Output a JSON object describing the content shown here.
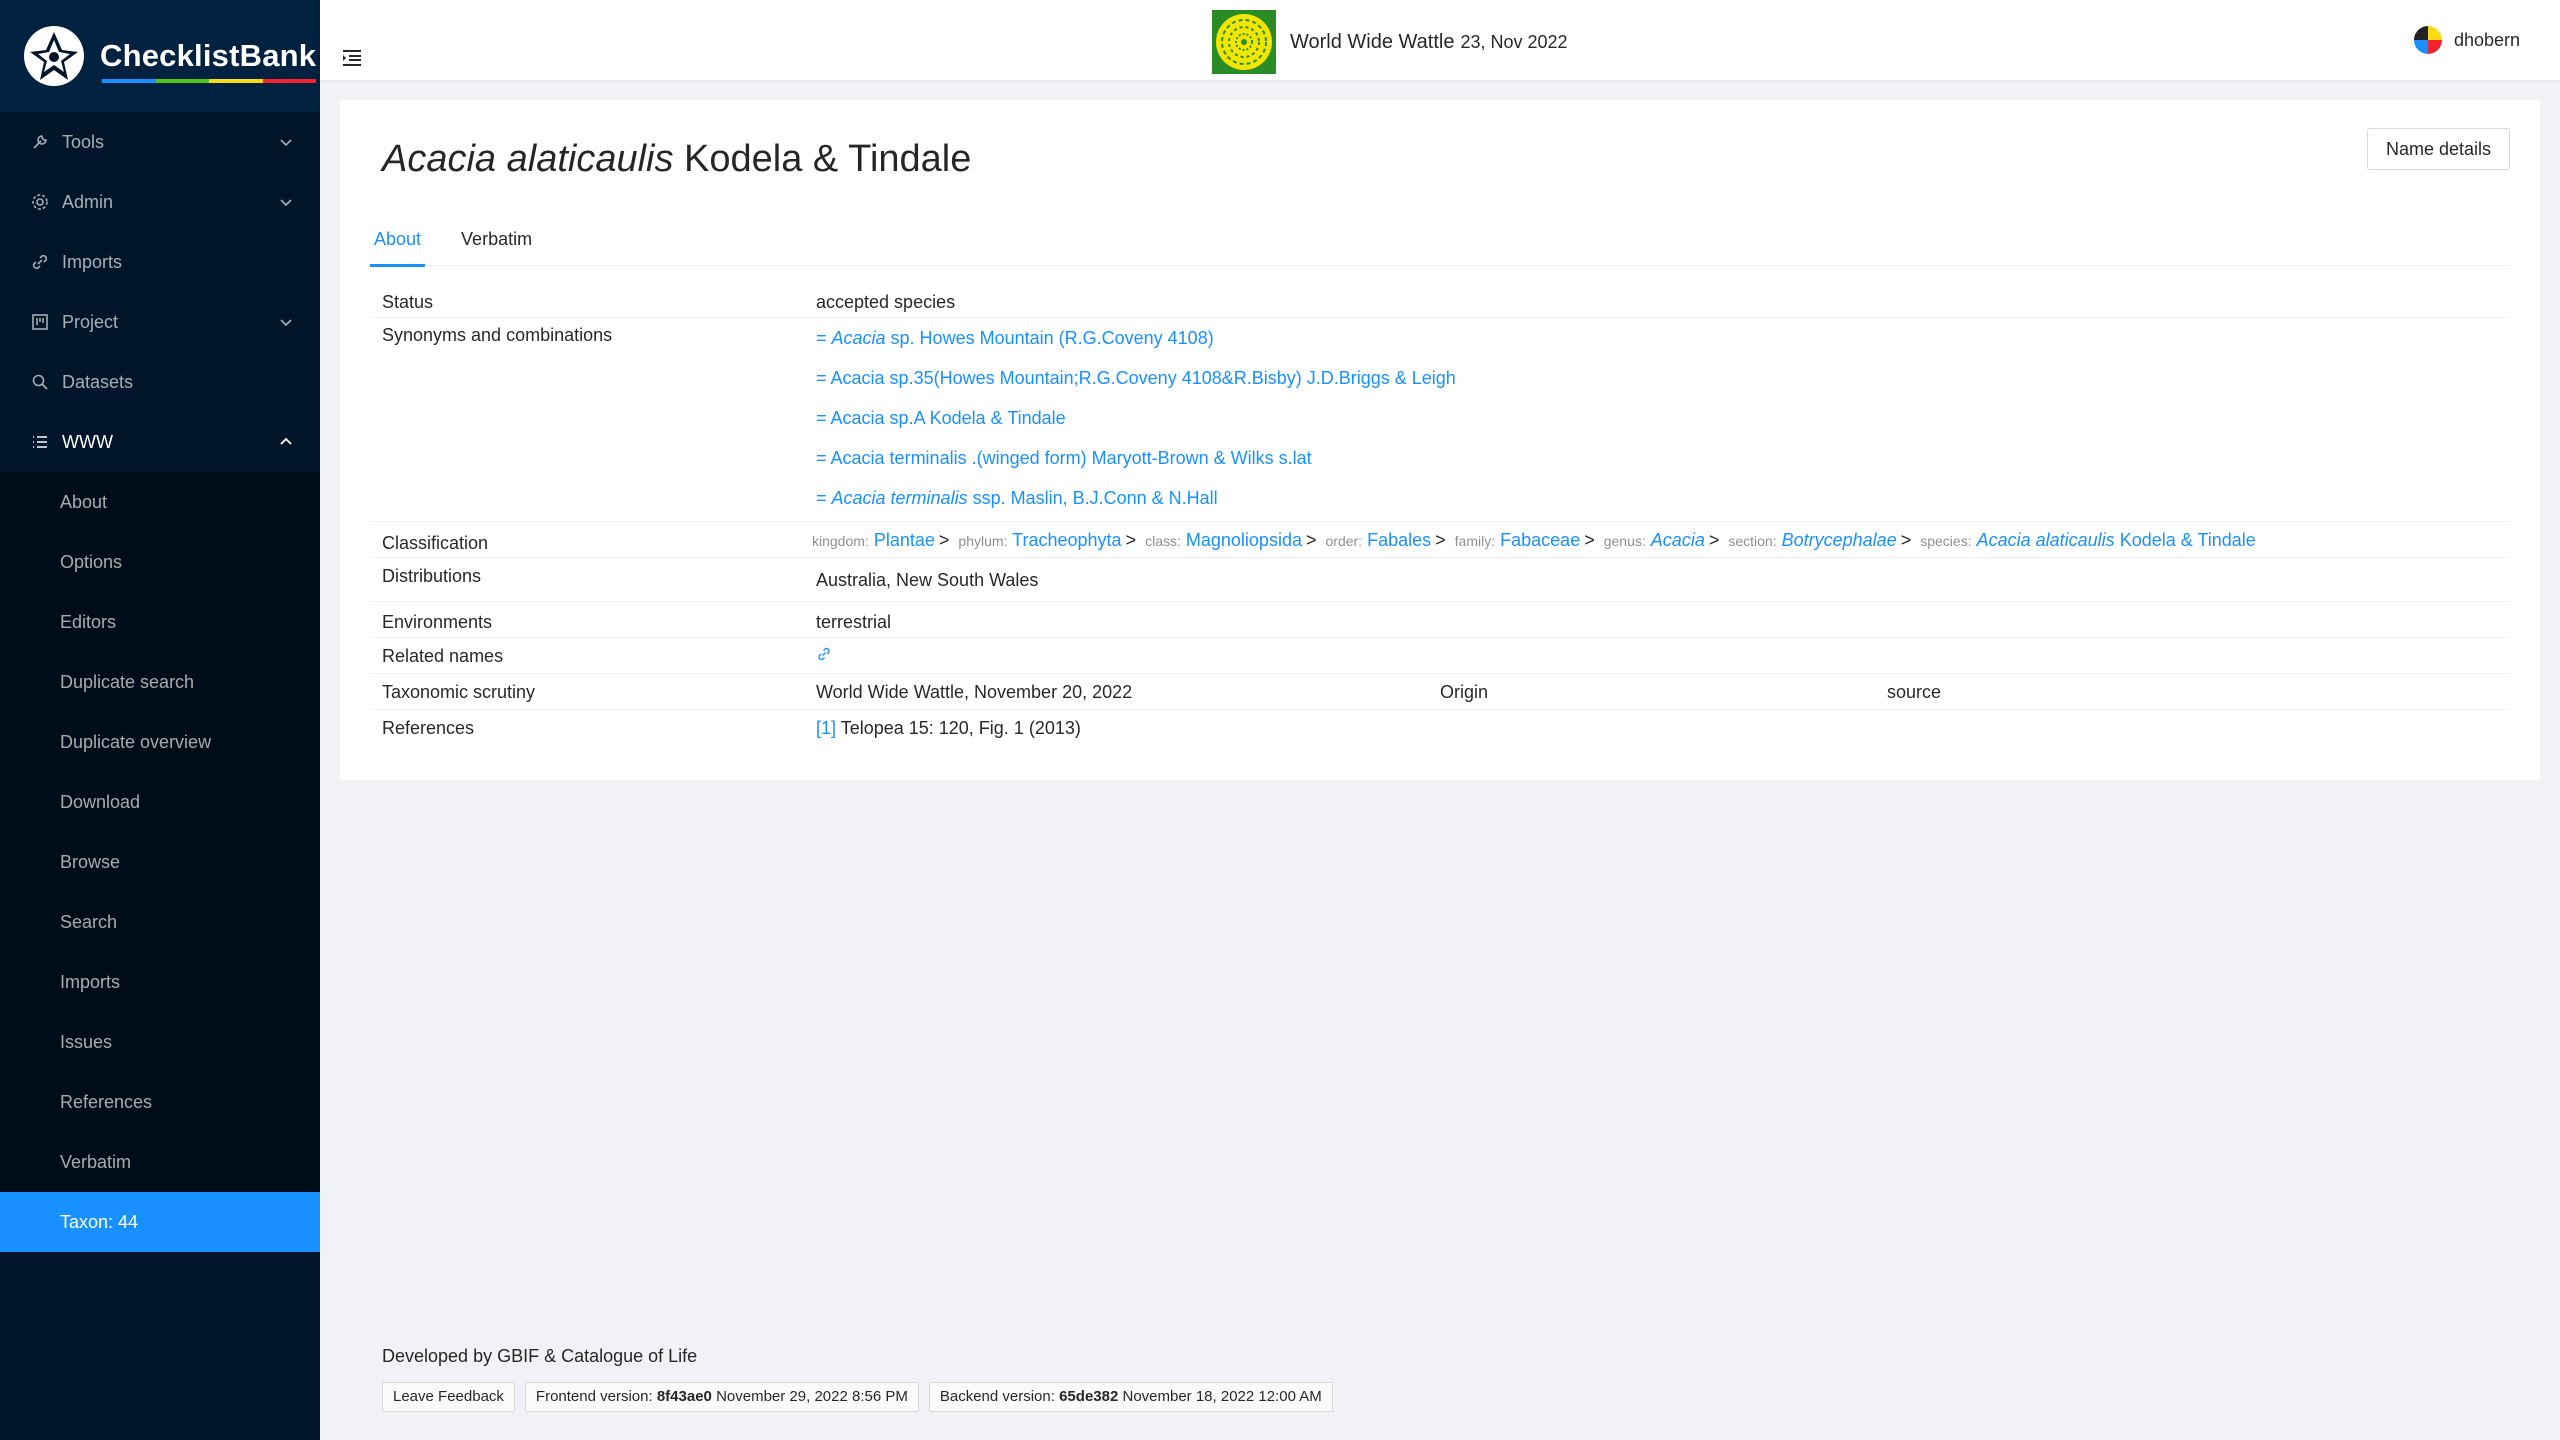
{
  "app": {
    "name": "ChecklistBank",
    "logo_bar_colors": [
      "#1890ff",
      "#52c41a",
      "#fadb14",
      "#f5222d"
    ]
  },
  "sidebar": {
    "top_items": [
      {
        "label": "Tools",
        "icon": "wrench-icon",
        "expandable": true
      },
      {
        "label": "Admin",
        "icon": "gear-icon",
        "expandable": true
      },
      {
        "label": "Imports",
        "icon": "link-icon",
        "expandable": false
      },
      {
        "label": "Project",
        "icon": "project-icon",
        "expandable": true
      },
      {
        "label": "Datasets",
        "icon": "search-icon",
        "expandable": false
      },
      {
        "label": "WWW",
        "icon": "list-icon",
        "expandable": true
      }
    ],
    "sub_items": [
      "About",
      "Options",
      "Editors",
      "Duplicate search",
      "Duplicate overview",
      "Download",
      "Browse",
      "Search",
      "Imports",
      "Issues",
      "References",
      "Verbatim",
      "Taxon: 44"
    ],
    "selected": "Taxon: 44"
  },
  "header": {
    "dataset_title": "World Wide Wattle",
    "dataset_date": "23, Nov 2022",
    "username": "dhobern"
  },
  "taxon": {
    "name_italic": "Acacia alaticaulis",
    "authorship": "Kodela & Tindale",
    "name_details_button": "Name details",
    "tabs": [
      "About",
      "Verbatim"
    ],
    "active_tab": "About",
    "labels": {
      "status": "Status",
      "synonyms": "Synonyms and combinations",
      "classification": "Classification",
      "distributions": "Distributions",
      "environments": "Environments",
      "related": "Related names",
      "scrutiny": "Taxonomic scrutiny",
      "references": "References"
    },
    "status": "accepted species",
    "synonyms": [
      {
        "prefix": "= ",
        "italic": "Acacia",
        "rest": " sp. Howes Mountain (R.G.Coveny 4108)"
      },
      {
        "prefix": "= ",
        "italic": "",
        "rest": "Acacia sp.35(Howes Mountain;R.G.Coveny 4108&R.Bisby) J.D.Briggs & Leigh"
      },
      {
        "prefix": "= ",
        "italic": "",
        "rest": "Acacia sp.A Kodela & Tindale"
      },
      {
        "prefix": "= ",
        "italic": "",
        "rest": "Acacia terminalis .(winged form) Maryott-Brown & Wilks s.lat"
      },
      {
        "prefix": "= ",
        "italic": "Acacia terminalis",
        "rest": " ssp. Maslin, B.J.Conn & N.Hall"
      }
    ],
    "classification": [
      {
        "rank": "kingdom:",
        "name": "Plantae",
        "italic": false
      },
      {
        "rank": "phylum:",
        "name": "Tracheophyta",
        "italic": false
      },
      {
        "rank": "class:",
        "name": "Magnoliopsida",
        "italic": false
      },
      {
        "rank": "order:",
        "name": "Fabales",
        "italic": false
      },
      {
        "rank": "family:",
        "name": "Fabaceae",
        "italic": false
      },
      {
        "rank": "genus:",
        "name": "Acacia",
        "italic": true
      },
      {
        "rank": "section:",
        "name": "Botrycephalae",
        "italic": true
      },
      {
        "rank": "species:",
        "name": "Acacia alaticaulis",
        "italic": true,
        "suffix": " Kodela & Tindale"
      }
    ],
    "classification_separator": ">",
    "distributions": "Australia, New South Wales",
    "environments": "terrestrial",
    "scrutiny": {
      "value": "World Wide Wattle, November 20, 2022",
      "origin_label": "Origin",
      "origin_value": "source"
    },
    "reference": {
      "index": "[1]",
      "text": " Telopea 15: 120, Fig. 1 (2013)"
    }
  },
  "footer": {
    "developed_by": "Developed by GBIF & Catalogue of Life",
    "feedback": "Leave Feedback",
    "frontend_label": "Frontend version:",
    "frontend_hash": "8f43ae0",
    "frontend_date": "November 29, 2022 8:56 PM",
    "backend_label": "Backend version:",
    "backend_hash": "65de382",
    "backend_date": "November 18, 2022 12:00 AM"
  },
  "colors": {
    "sidebar_bg": "#001529",
    "submenu_bg": "#000c17",
    "accent": "#1890ff",
    "content_bg": "#f0f2f5"
  }
}
